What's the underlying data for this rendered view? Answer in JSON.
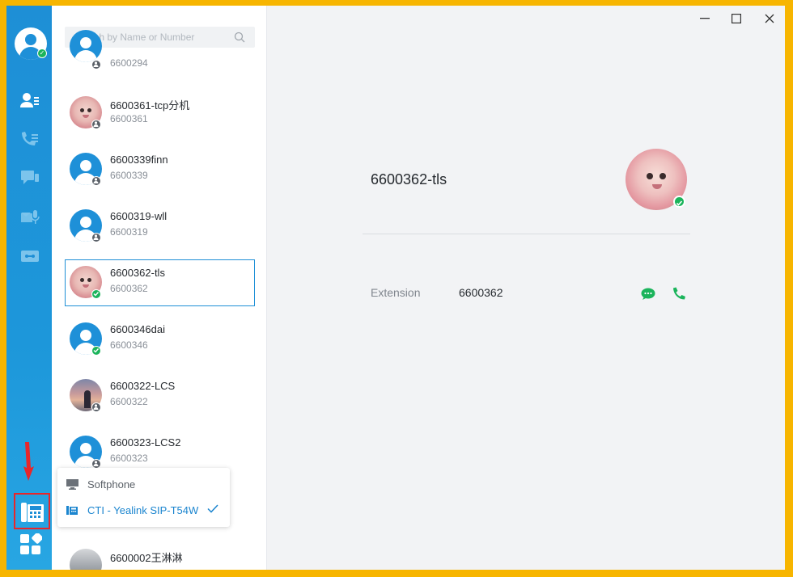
{
  "rail": {
    "nav_icons": [
      "contacts-icon",
      "call-history-icon",
      "messages-icon",
      "voicemail-icon",
      "devices-icon"
    ],
    "device_icon": "desk-phone-icon",
    "apps_icon": "apps-icon"
  },
  "search": {
    "placeholder": "Search by Name or Number"
  },
  "contacts": [
    {
      "name": "",
      "number": "6600294",
      "status": "offline"
    },
    {
      "name": "6600361-tcp分机",
      "number": "6600361",
      "status": "offline"
    },
    {
      "name": "6600339finn",
      "number": "6600339",
      "status": "offline"
    },
    {
      "name": "6600319-wll",
      "number": "6600319",
      "status": "offline"
    },
    {
      "name": "6600362-tls",
      "number": "6600362",
      "status": "online",
      "selected": true
    },
    {
      "name": "6600346dai",
      "number": "6600346",
      "status": "online"
    },
    {
      "name": "6600322-LCS",
      "number": "6600322",
      "status": "offline"
    },
    {
      "name": "6600323-LCS2",
      "number": "6600323",
      "status": "offline"
    },
    {
      "name": "6600002王淋淋",
      "number": "",
      "status": ""
    }
  ],
  "device_menu": {
    "options": [
      {
        "label": "Softphone",
        "icon": "computer-icon",
        "selected": false
      },
      {
        "label": "CTI - Yealink SIP-T54W",
        "icon": "desk-phone-icon",
        "selected": true
      }
    ]
  },
  "detail": {
    "name": "6600362-tls",
    "status": "online",
    "extension_label": "Extension",
    "extension_value": "6600362"
  },
  "colors": {
    "rail": "#1e8fd6",
    "accent": "#1b85cf",
    "online": "#1bb45b",
    "highlight_border": "#e8262a",
    "outer_border": "#f7b500"
  }
}
